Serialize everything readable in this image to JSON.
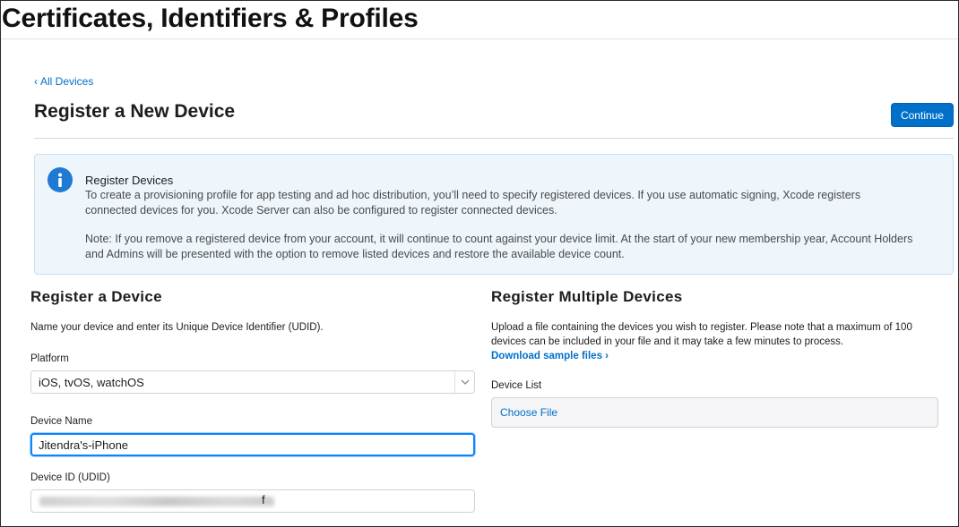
{
  "app": {
    "title": "Certificates, Identifiers & Profiles"
  },
  "nav": {
    "back_label": "All Devices"
  },
  "header": {
    "title": "Register a New Device",
    "continue_label": "Continue"
  },
  "info": {
    "title": "Register Devices",
    "text": "To create a provisioning profile for app testing and ad hoc distribution, you’ll need to specify registered devices. If you use automatic signing, Xcode registers connected devices for you. Xcode Server can also be configured to register connected devices.",
    "note": "Note: If you remove a registered device from your account, it will continue to count against your device limit. At the start of your new membership year, Account Holders and Admins will be presented with the option to remove listed devices and restore the available device count."
  },
  "single": {
    "title": "Register a Device",
    "description": "Name your device and enter its Unique Device Identifier (UDID).",
    "platform_label": "Platform",
    "platform_value": "iOS, tvOS, watchOS",
    "device_name_label": "Device Name",
    "device_name_value": "Jitendra's-iPhone",
    "device_id_label": "Device ID (UDID)",
    "device_id_visible_tail": "f"
  },
  "multiple": {
    "title": "Register Multiple Devices",
    "description": "Upload a file containing the devices you wish to register. Please note that a maximum of 100 devices can be included in your file and it may take a few minutes to process.",
    "download_label": "Download sample files ›",
    "device_list_label": "Device List",
    "choose_file_label": "Choose File"
  },
  "colors": {
    "accent": "#0070c9",
    "info_bg": "#eef6fc",
    "info_icon": "#1f7ad4",
    "focus": "#0a84ff"
  }
}
